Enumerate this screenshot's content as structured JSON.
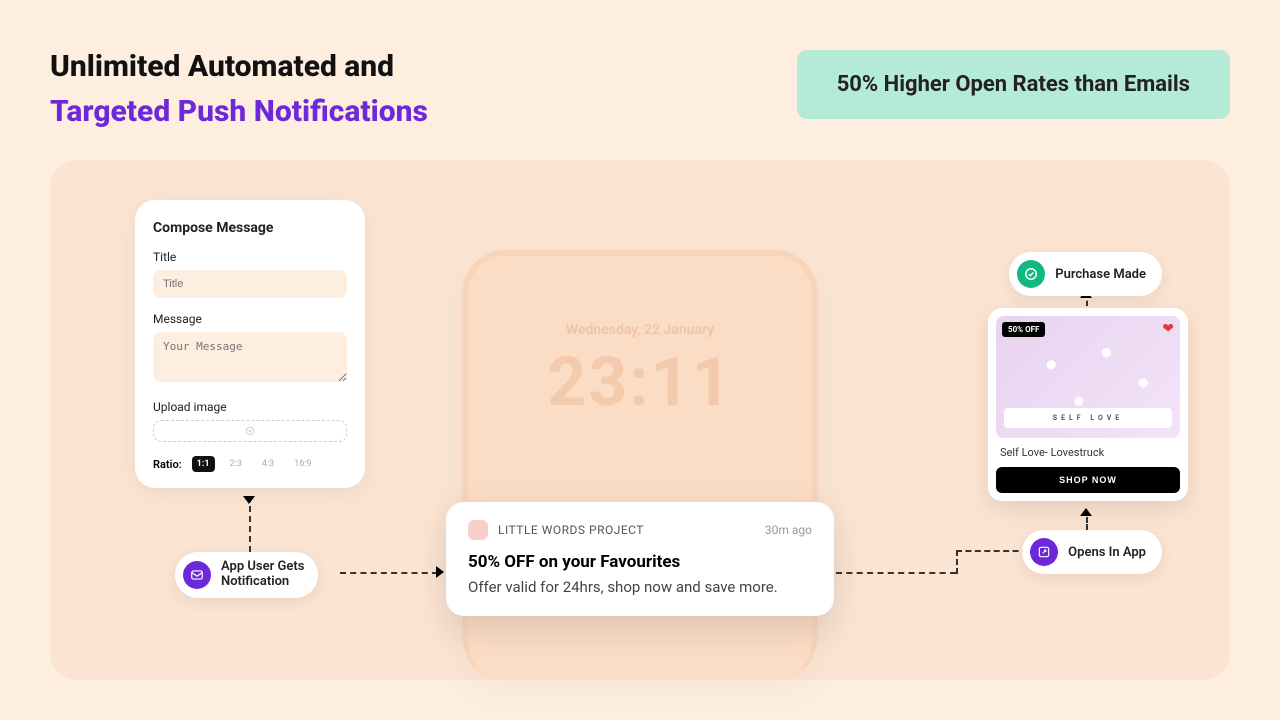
{
  "header": {
    "line1": "Unlimited Automated and",
    "line2": "Targeted Push Notifications",
    "open_rate_badge": "50% Higher Open Rates than Emails"
  },
  "compose": {
    "card_title": "Compose Message",
    "title_label": "Title",
    "title_placeholder": "Title",
    "message_label": "Message",
    "message_placeholder": "Your Message",
    "upload_label": "Upload image",
    "ratio_label": "Ratio:",
    "ratios": {
      "r1": "1:1",
      "r2": "2:3",
      "r3": "4:3",
      "r4": "16:9"
    }
  },
  "phone": {
    "date": "Wednesday, 22 January",
    "time": "23:11"
  },
  "notification": {
    "app": "LITTLE WORDS PROJECT",
    "time": "30m ago",
    "title": "50% OFF on your Favourites",
    "body": "Offer valid for 24hrs, shop now and save more."
  },
  "product": {
    "badge": "50% OFF",
    "ribbon": "SELF LOVE",
    "name": "Self Love- Lovestruck",
    "cta": "SHOP NOW"
  },
  "pills": {
    "purchase": "Purchase Made",
    "opens": "Opens In App",
    "user_gets_l1": "App User Gets",
    "user_gets_l2": "Notification"
  }
}
